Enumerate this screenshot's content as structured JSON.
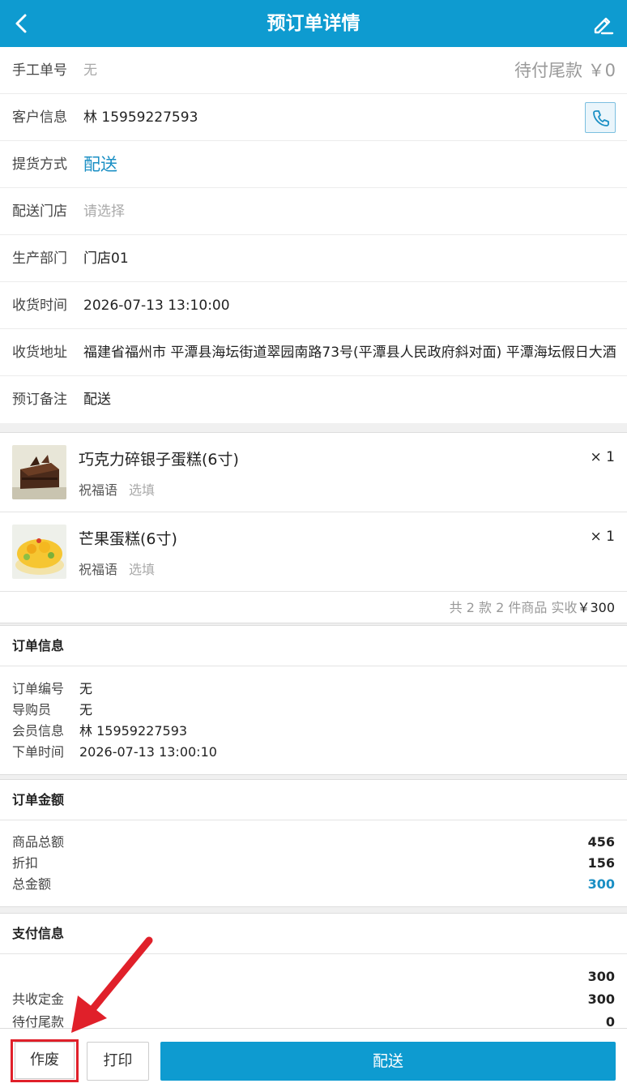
{
  "header": {
    "title": "预订单详情"
  },
  "form": {
    "manual_no": {
      "label": "手工单号",
      "value": "无",
      "balance": "待付尾款 ￥0"
    },
    "customer": {
      "label": "客户信息",
      "value": "林 15959227593"
    },
    "pickup": {
      "label": "提货方式",
      "value": "配送"
    },
    "store": {
      "label": "配送门店",
      "placeholder": "请选择"
    },
    "dept": {
      "label": "生产部门",
      "value": "门店01"
    },
    "receive_time": {
      "label": "收货时间",
      "value": "2026-07-13 13:10:00"
    },
    "address": {
      "label": "收货地址",
      "value": "福建省福州市 平潭县海坛街道翠园南路73号(平潭县人民政府斜对面) 平潭海坛假日大酒店"
    },
    "remark": {
      "label": "预订备注",
      "value": "配送"
    }
  },
  "goods": {
    "items": [
      {
        "name": "巧克力碎银子蛋糕(6寸)",
        "bless_label": "祝福语",
        "bless_placeholder": "选填",
        "qty": "× 1"
      },
      {
        "name": "芒果蛋糕(6寸)",
        "bless_label": "祝福语",
        "bless_placeholder": "选填",
        "qty": "× 1"
      }
    ],
    "summary_prefix": "共 2 款 2 件商品 实收",
    "summary_amount": "￥300"
  },
  "order_info": {
    "title": "订单信息",
    "rows": [
      {
        "k": "订单编号",
        "v": "无"
      },
      {
        "k": "导购员",
        "v": "无"
      },
      {
        "k": "会员信息",
        "v": "林 15959227593"
      },
      {
        "k": "下单时间",
        "v": "2026-07-13 13:00:10"
      }
    ]
  },
  "order_amount": {
    "title": "订单金额",
    "rows": [
      {
        "k": "商品总额",
        "v": "456"
      },
      {
        "k": "折扣",
        "v": "156"
      },
      {
        "k": "总金额",
        "v": "300"
      }
    ]
  },
  "pay_info": {
    "title": "支付信息",
    "rows": [
      {
        "k": "",
        "v": "300"
      },
      {
        "k": "共收定金",
        "v": "300"
      },
      {
        "k": "待付尾款",
        "v": "0"
      }
    ]
  },
  "bottom": {
    "void_label": "作废",
    "print_label": "打印",
    "deliver_label": "配送"
  },
  "colors": {
    "brand": "#0e9bd0",
    "accent_text": "#1a8fc4",
    "highlight": "#e0202a"
  }
}
